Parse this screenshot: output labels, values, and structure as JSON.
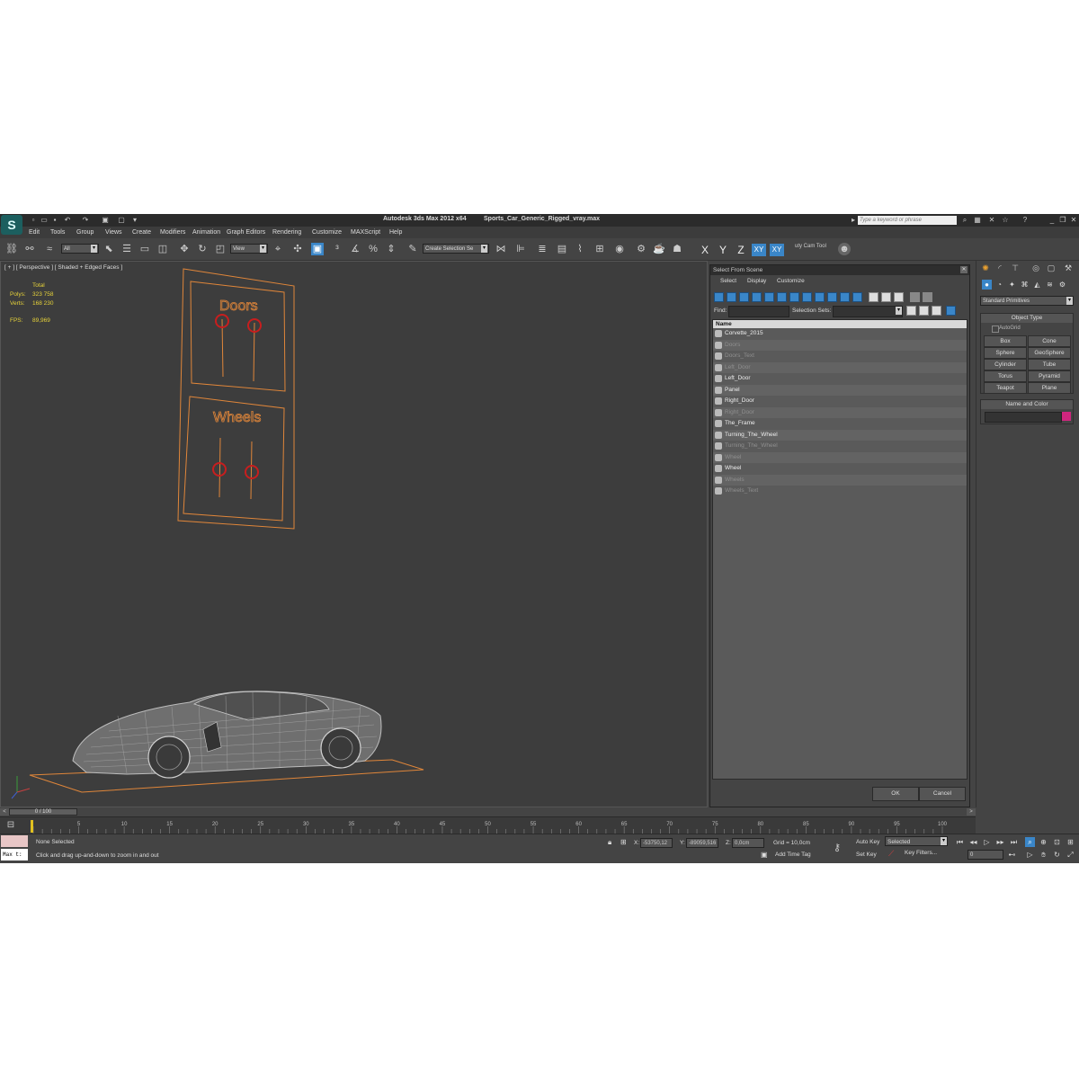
{
  "titlebar": {
    "app_title": "Autodesk 3ds Max  2012 x64",
    "file_name": "Sports_Car_Generic_Rigged_vray.max",
    "search_placeholder": "Type a keyword or phrase"
  },
  "menu": [
    "Edit",
    "Tools",
    "Group",
    "Views",
    "Create",
    "Modifiers",
    "Animation",
    "Graph Editors",
    "Rendering",
    "Customize",
    "MAXScript",
    "Help"
  ],
  "toolbar": {
    "filter_value": "All",
    "refcoord_value": "View",
    "selection_set_value": "Create Selection Se",
    "axes": [
      "X",
      "Y",
      "Z",
      "XY",
      "XY"
    ],
    "cam_tool": "uty Cam Tool"
  },
  "viewport": {
    "label": "[ + ] [ Perspective ] [ Shaded + Edged Faces ]",
    "stats": {
      "total_label": "Total",
      "polys_label": "Polys:",
      "polys_value": "323 758",
      "verts_label": "Verts:",
      "verts_value": "168 230",
      "fps_label": "FPS:",
      "fps_value": "89,969"
    },
    "controls": {
      "doors_label": "Doors",
      "wheels_label": "Wheels"
    }
  },
  "dialog": {
    "title": "Select From Scene",
    "menu": [
      "Select",
      "Display",
      "Customize"
    ],
    "find_label": "Find:",
    "selection_sets_label": "Selection Sets:",
    "column_header": "Name",
    "items": [
      {
        "name": "Corvette_2015",
        "dim": false
      },
      {
        "name": "Doors",
        "dim": true
      },
      {
        "name": "Doors_Text",
        "dim": true
      },
      {
        "name": "Left_Door",
        "dim": true
      },
      {
        "name": "Left_Door",
        "dim": false
      },
      {
        "name": "Panel",
        "dim": false
      },
      {
        "name": "Right_Door",
        "dim": false
      },
      {
        "name": "Right_Door",
        "dim": true
      },
      {
        "name": "The_Frame",
        "dim": false
      },
      {
        "name": "Turning_The_Wheel",
        "dim": false
      },
      {
        "name": "Turning_The_Wheel",
        "dim": true
      },
      {
        "name": "Wheel",
        "dim": true
      },
      {
        "name": "Wheel",
        "dim": false
      },
      {
        "name": "Wheels",
        "dim": true
      },
      {
        "name": "Wheels_Text",
        "dim": true
      }
    ],
    "ok_label": "OK",
    "cancel_label": "Cancel"
  },
  "command_panel": {
    "category": "Standard Primitives",
    "object_type_title": "Object Type",
    "autogrid_label": "AutoGrid",
    "primitives": [
      "Box",
      "Cone",
      "Sphere",
      "GeoSphere",
      "Cylinder",
      "Tube",
      "Torus",
      "Pyramid",
      "Teapot",
      "Plane"
    ],
    "name_color_title": "Name and Color",
    "object_color": "#d0267e"
  },
  "timeline": {
    "frame_display": "0 / 100",
    "ticks": [
      "0",
      "5",
      "10",
      "15",
      "20",
      "25",
      "30",
      "35",
      "40",
      "45",
      "50",
      "55",
      "60",
      "65",
      "70",
      "75",
      "80",
      "85",
      "90",
      "95",
      "100"
    ]
  },
  "status": {
    "maxscript_text": "Max t:",
    "selection_text": "None Selected",
    "prompt_text": "Click and drag up-and-down to zoom in and out",
    "x_label": "X:",
    "x_value": "-53750,12",
    "y_label": "Y:",
    "y_value": "-89059,516",
    "z_label": "Z:",
    "z_value": "0,0cm",
    "grid_text": "Grid = 10,0cm",
    "add_time_tag": "Add Time Tag",
    "auto_key": "Auto Key",
    "auto_key_mode": "Selected",
    "set_key": "Set Key",
    "key_filters": "Key Filters...",
    "current_frame": "0"
  },
  "colors": {
    "accent": "#3a86c8",
    "selection_orange": "#e0863a",
    "control_red": "#c81e1e",
    "stats_yellow": "#e6d23a"
  }
}
